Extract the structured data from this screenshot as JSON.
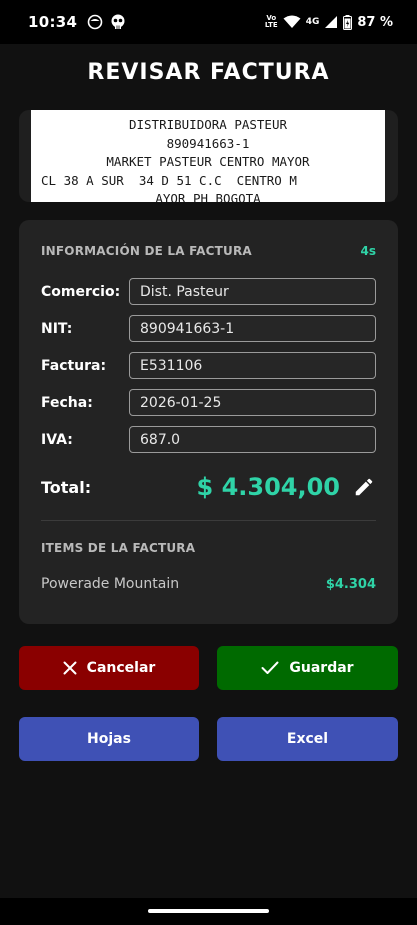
{
  "status_bar": {
    "time": "10:34",
    "volte_top": "Vo",
    "volte_bottom": "LTE",
    "network": "4G",
    "battery": "87 %"
  },
  "page": {
    "title": "REVISAR FACTURA"
  },
  "receipt": {
    "lines": [
      "DISTRIBUIDORA PASTEUR",
      "890941663-1",
      "MARKET PASTEUR CENTRO MAYOR",
      "CL 38 A SUR  34 D 51 C.C  CENTRO M",
      "AYOR PH BOGOTA"
    ]
  },
  "invoice": {
    "section_label": "INFORMACIÓN DE LA FACTURA",
    "timer": "4s",
    "fields": [
      {
        "label": "Comercio:",
        "value": "Dist. Pasteur"
      },
      {
        "label": "NIT:",
        "value": "890941663-1"
      },
      {
        "label": "Factura:",
        "value": "E531106"
      },
      {
        "label": "Fecha:",
        "value": "2026-01-25"
      },
      {
        "label": "IVA:",
        "value": "687.0"
      }
    ],
    "total_label": "Total:",
    "total_value": "$ 4.304,00",
    "items_label": "ITEMS DE LA FACTURA",
    "items": [
      {
        "name": "Powerade Mountain",
        "price": "$4.304"
      }
    ]
  },
  "actions": {
    "cancel": "Cancelar",
    "save": "Guardar",
    "sheets": "Hojas",
    "excel": "Excel"
  },
  "colors": {
    "accent_teal": "#2fd3a7",
    "cancel_red": "#8a0000",
    "save_green": "#006a00",
    "indigo": "#3f51b5"
  }
}
